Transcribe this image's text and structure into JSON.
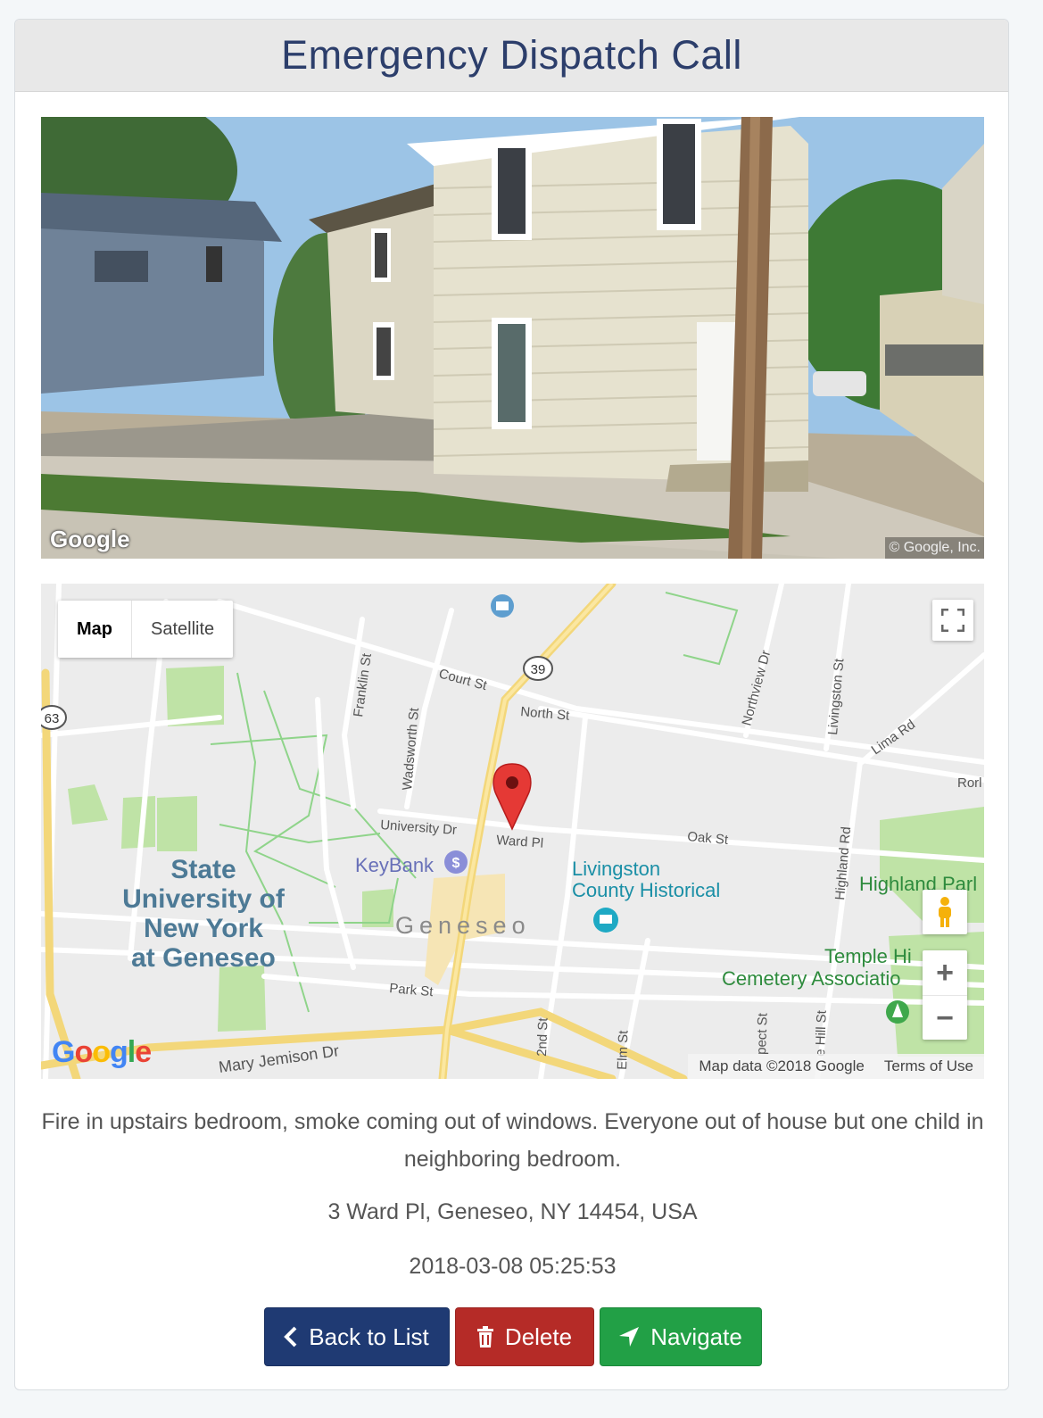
{
  "header": {
    "title": "Emergency Dispatch Call"
  },
  "streetview": {
    "logo": "Google",
    "copyright": "© Google, Inc."
  },
  "map": {
    "type_control": {
      "map_label": "Map",
      "satellite_label": "Satellite"
    },
    "labels": {
      "court_st": "Court St",
      "north_st": "North St",
      "route_39": "39",
      "route_63": "63",
      "franklin_st": "Franklin St",
      "wadsworth_st": "Wadsworth St",
      "northview_dr": "Northview Dr",
      "livingston_st": "Livingston St",
      "lima_rd": "Lima Rd",
      "rorl": "Rorl",
      "university_dr": "University Dr",
      "ward_pl": "Ward Pl",
      "oak_st": "Oak St",
      "keybank": "KeyBank",
      "suny_1": "State",
      "suny_2": "University of",
      "suny_3": "New York",
      "suny_4": "at Geneseo",
      "livingston_1": "Livingston",
      "livingston_2": "County Historical",
      "geneseo": "Geneseo",
      "highland_rd": "Highland Rd",
      "highland_park": "Highland Parl",
      "temple_1": "Temple Hi",
      "temple_2": "Cemetery Associatio",
      "park_st": "Park St",
      "second_st": "2nd St",
      "elm_st": "Elm St",
      "prospect_st": "pect St",
      "hill_st": "e Hill St",
      "mary_jemison_dr": "Mary Jemison Dr"
    },
    "logo": "Google",
    "map_data": "Map data ©2018 Google",
    "terms": "Terms of Use",
    "icons": {
      "fullscreen": "fullscreen-icon",
      "pegman": "pegman-icon",
      "zoom_in": "+",
      "zoom_out": "−",
      "marker": "map-marker-icon"
    }
  },
  "call": {
    "description": "Fire in upstairs bedroom, smoke coming out of windows. Everyone out of house but one child in neighboring bedroom.",
    "address": "3 Ward Pl, Geneseo, NY 14454, USA",
    "timestamp": "2018-03-08 05:25:53"
  },
  "actions": {
    "back_label": "Back to List",
    "delete_label": "Delete",
    "navigate_label": "Navigate"
  },
  "colors": {
    "header_text": "#2c3e6b",
    "back_button": "#1f3a73",
    "delete_button": "#b52b27",
    "navigate_button": "#22a046",
    "marker": "#e53935"
  }
}
